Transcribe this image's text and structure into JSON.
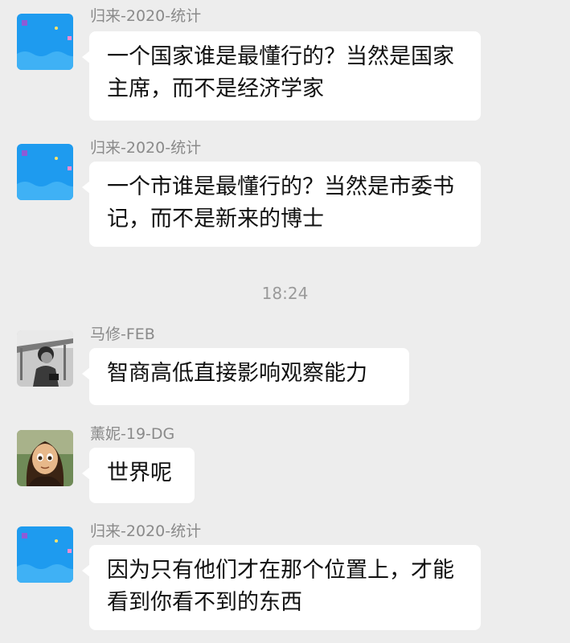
{
  "chat": {
    "messages": [
      {
        "sender": "归来-2020-统计",
        "text": "一个国家谁是最懂行的？当然是国家主席，而不是经济学家",
        "avatar": "blue-sky-balloon-avatar"
      },
      {
        "sender": "归来-2020-统计",
        "text": "一个市谁是最懂行的？当然是市委书记，而不是新来的博士",
        "avatar": "blue-sky-balloon-avatar"
      },
      {
        "sender": "马修-FEB",
        "text": "智商高低直接影响观察能力",
        "avatar": "grayscale-photo-avatar"
      },
      {
        "sender": "薰妮-19-DG",
        "text": "世界呢",
        "avatar": "mona-lisa-cartoon-avatar"
      },
      {
        "sender": "归来-2020-统计",
        "text": "因为只有他们才在那个位置上，才能看到你看不到的东西",
        "avatar": "blue-sky-balloon-avatar"
      }
    ],
    "timestamp": "18:24"
  },
  "colors": {
    "background": "#ededed",
    "bubble": "#ffffff",
    "sender_text": "#8a8a8a",
    "message_text": "#111111",
    "avatar_blue": "#1e9bef"
  }
}
